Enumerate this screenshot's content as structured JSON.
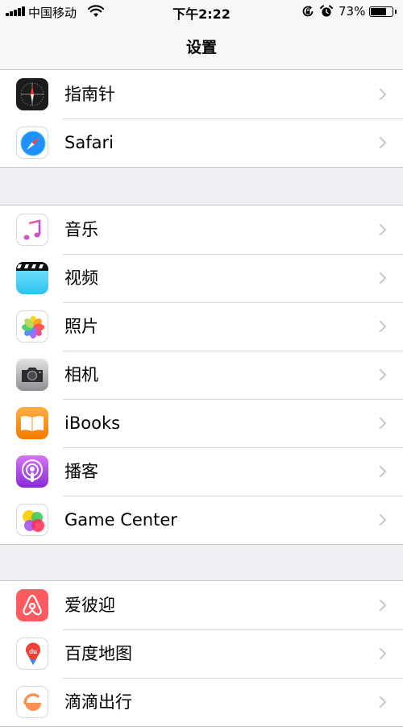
{
  "status_bar": {
    "carrier": "中国移动",
    "time": "下午2:22",
    "battery": "73%",
    "battery_level": 0.73,
    "icons": [
      "signal-icon",
      "wifi-icon",
      "orientation-lock-icon",
      "alarm-icon",
      "battery-icon"
    ]
  },
  "nav": {
    "title": "设置"
  },
  "groups": [
    {
      "items": [
        {
          "label": "指南针",
          "icon": "compass-icon"
        },
        {
          "label": "Safari",
          "icon": "safari-icon"
        }
      ]
    },
    {
      "items": [
        {
          "label": "音乐",
          "icon": "music-icon"
        },
        {
          "label": "视频",
          "icon": "videos-icon"
        },
        {
          "label": "照片",
          "icon": "photos-icon"
        },
        {
          "label": "相机",
          "icon": "camera-icon"
        },
        {
          "label": "iBooks",
          "icon": "ibooks-icon"
        },
        {
          "label": "播客",
          "icon": "podcasts-icon"
        },
        {
          "label": "Game Center",
          "icon": "game-center-icon"
        }
      ]
    },
    {
      "items": [
        {
          "label": "爱彼迎",
          "icon": "airbnb-icon"
        },
        {
          "label": "百度地图",
          "icon": "baidu-maps-icon"
        },
        {
          "label": "滴滴出行",
          "icon": "didi-icon"
        }
      ]
    }
  ],
  "icon_labels": {
    "baidu_maps_glyph": "du"
  }
}
